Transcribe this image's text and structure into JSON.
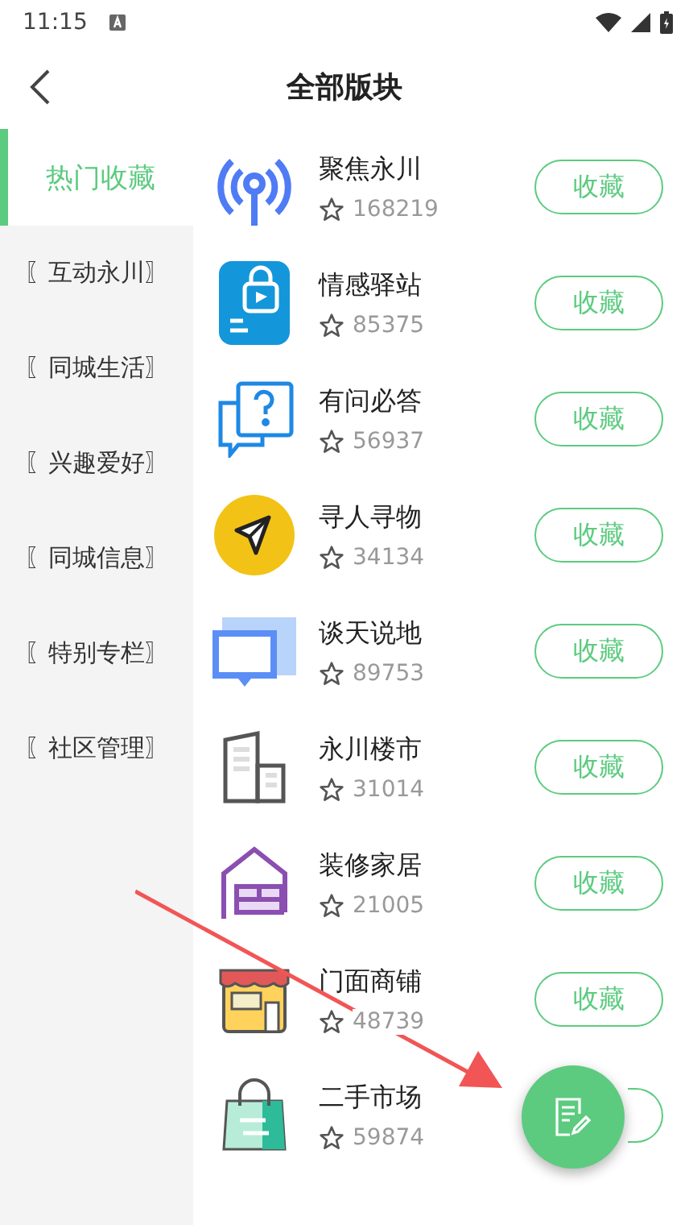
{
  "status_bar": {
    "time": "11:15"
  },
  "header": {
    "title": "全部版块"
  },
  "sidebar": {
    "items": [
      {
        "label": "热门收藏",
        "selected": true
      },
      {
        "label": "〖互动永川〗",
        "selected": false
      },
      {
        "label": "〖同城生活〗",
        "selected": false
      },
      {
        "label": "〖兴趣爱好〗",
        "selected": false
      },
      {
        "label": "〖同城信息〗",
        "selected": false
      },
      {
        "label": "〖特别专栏〗",
        "selected": false
      },
      {
        "label": "〖社区管理〗",
        "selected": false
      }
    ]
  },
  "boards": [
    {
      "name": "聚焦永川",
      "count": "168219",
      "button": "收藏"
    },
    {
      "name": "情感驿站",
      "count": "85375",
      "button": "收藏"
    },
    {
      "name": "有问必答",
      "count": "56937",
      "button": "收藏"
    },
    {
      "name": "寻人寻物",
      "count": "34134",
      "button": "收藏"
    },
    {
      "name": "谈天说地",
      "count": "89753",
      "button": "收藏"
    },
    {
      "name": "永川楼市",
      "count": "31014",
      "button": "收藏"
    },
    {
      "name": "装修家居",
      "count": "21005",
      "button": "收藏"
    },
    {
      "name": "门面商铺",
      "count": "48739",
      "button": "收藏"
    },
    {
      "name": "二手市场",
      "count": "59874"
    }
  ]
}
